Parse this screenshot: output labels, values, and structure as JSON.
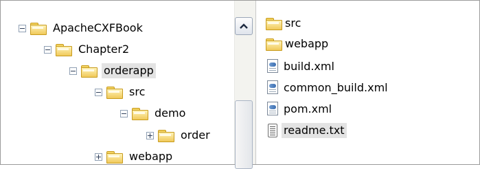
{
  "tree": {
    "nodes": [
      {
        "label": "ApacheCXFBook",
        "expander": "minus",
        "icon": "folder-icon",
        "selected": false
      },
      {
        "label": "Chapter2",
        "expander": "minus",
        "icon": "folder-icon",
        "selected": false
      },
      {
        "label": "orderapp",
        "expander": "minus",
        "icon": "folder-open-icon",
        "selected": true
      },
      {
        "label": "src",
        "expander": "minus",
        "icon": "folder-icon",
        "selected": false
      },
      {
        "label": "demo",
        "expander": "minus",
        "icon": "folder-icon",
        "selected": false
      },
      {
        "label": "order",
        "expander": "plus",
        "icon": "folder-icon",
        "selected": false
      },
      {
        "label": "webapp",
        "expander": "plus",
        "icon": "folder-icon",
        "selected": false
      }
    ]
  },
  "scrollbar": {
    "up_icon": "chevron-up-icon"
  },
  "files": {
    "items": [
      {
        "label": "src",
        "icon": "folder-icon",
        "selected": false
      },
      {
        "label": "webapp",
        "icon": "folder-icon",
        "selected": false
      },
      {
        "label": "build.xml",
        "icon": "xml-file-icon",
        "selected": false
      },
      {
        "label": "common_build.xml",
        "icon": "xml-file-icon",
        "selected": false
      },
      {
        "label": "pom.xml",
        "icon": "xml-file-icon",
        "selected": false
      },
      {
        "label": "readme.txt",
        "icon": "text-file-icon",
        "selected": true
      }
    ]
  },
  "colors": {
    "selection": "#e3e3e3",
    "folder": "#f0c95a",
    "border": "#9a9a9a"
  }
}
